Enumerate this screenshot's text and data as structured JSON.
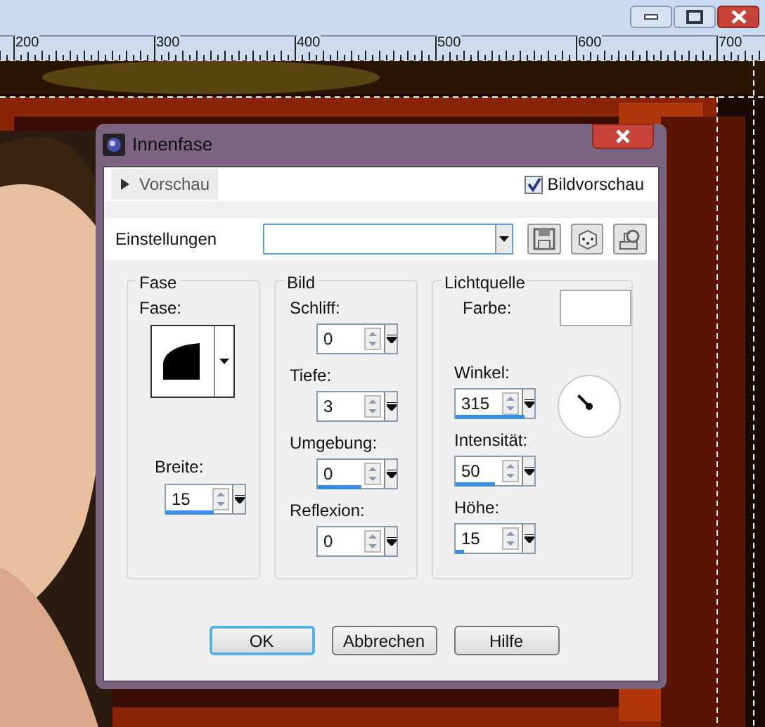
{
  "window_buttons": [
    {
      "kind": "minimize"
    },
    {
      "kind": "maximize"
    },
    {
      "kind": "close"
    }
  ],
  "ruler": {
    "labels": [
      "200",
      "300",
      "400",
      "500",
      "600",
      "700"
    ]
  },
  "dialog": {
    "title": "Innenfase",
    "preview_toggle": {
      "label": "Vorschau",
      "expanded": false
    },
    "image_preview": {
      "label": "Bildvorschau",
      "checked": true
    },
    "settings": {
      "label": "Einstellungen"
    },
    "fase": {
      "title": "Fase",
      "shape_label": "Fase:",
      "width": {
        "label": "Breite:",
        "value": "15",
        "level": 0.6
      }
    },
    "bild": {
      "title": "Bild",
      "fields": [
        {
          "label": "Schliff:",
          "value": "0",
          "level": 0
        },
        {
          "label": "Tiefe:",
          "value": "3",
          "level": 0
        },
        {
          "label": "Umgebung:",
          "value": "0",
          "level": 0.55
        },
        {
          "label": "Reflexion:",
          "value": "0",
          "level": 0
        }
      ]
    },
    "light": {
      "title": "Lichtquelle",
      "color_label": "Farbe:",
      "color": "#ffffff",
      "fields": [
        {
          "label": "Winkel:",
          "value": "315",
          "level": 0.88
        },
        {
          "label": "Intensität:",
          "value": "50",
          "level": 0.5
        },
        {
          "label": "Höhe:",
          "value": "15",
          "level": 0.1
        }
      ]
    },
    "buttons": [
      {
        "label": "OK",
        "default": true
      },
      {
        "label": "Abbrechen",
        "default": false
      },
      {
        "label": "Hilfe",
        "default": false
      }
    ]
  }
}
